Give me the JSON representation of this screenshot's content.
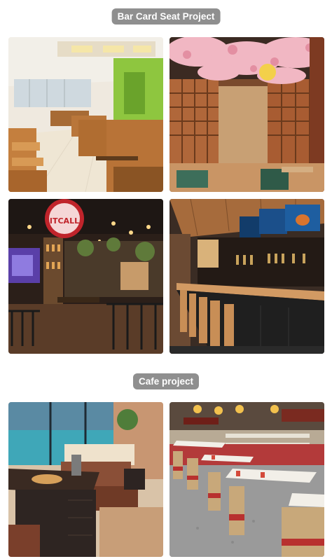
{
  "sections": [
    {
      "title": "Bar Card Seat Project"
    },
    {
      "title": "Cafe project"
    }
  ],
  "photos": {
    "p1": {
      "alt": ""
    },
    "p2": {
      "alt": ""
    },
    "p3": {
      "sign_line1": "",
      "sign_line2": "ITCALL"
    },
    "p4": {
      "alt": ""
    },
    "p5": {
      "alt": ""
    },
    "p6": {
      "alt": ""
    }
  }
}
